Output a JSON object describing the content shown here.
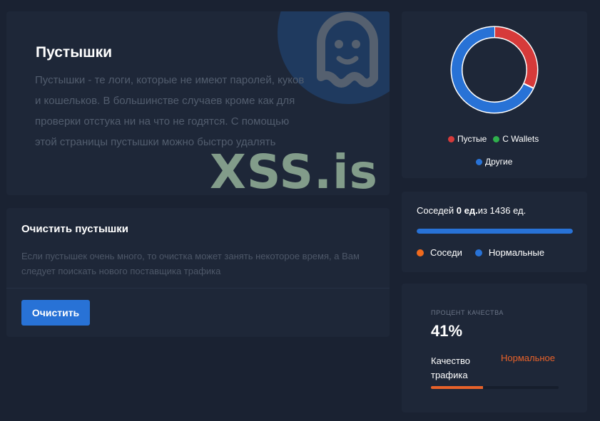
{
  "intro": {
    "title": "Пустышки",
    "description": "Пустышки - те логи, которые не имеют паролей, куков и кошельков. В большинстве случаев кроме как для проверки отстука ни на что не годятся. С помощью этой страницы пустышки можно быстро удалять",
    "watermark": "XSS.is",
    "icon": "ghost-icon"
  },
  "clean": {
    "title": "Очистить пустышки",
    "description": "Если пустышек очень много, то очистка может занять некоторое время, а Вам следует поискать нового поставщика трафика",
    "button_label": "Очистить"
  },
  "chart_data": {
    "type": "pie",
    "variant": "donut",
    "categories": [
      "Пустые",
      "С Wallets",
      "Другие"
    ],
    "values": [
      32,
      0,
      68
    ],
    "colors": [
      "#d63a3a",
      "#2fb04c",
      "#2872d6"
    ],
    "legend_position": "bottom"
  },
  "neighbours": {
    "prefix": "Соседей",
    "count": "0 ед.",
    "suffix": "из 1436 ед.",
    "progress_fraction": 1.0,
    "legend": [
      {
        "label": "Соседи",
        "color": "#f06a1d"
      },
      {
        "label": "Нормальные",
        "color": "#2872d6"
      }
    ]
  },
  "quality": {
    "label": "ПРОЦЕНТ КАЧЕСТВА",
    "value": "41%",
    "traffic_label": "Качество трафика",
    "status": "Нормальное",
    "progress_fraction": 0.41,
    "accent": "#e8622a"
  }
}
